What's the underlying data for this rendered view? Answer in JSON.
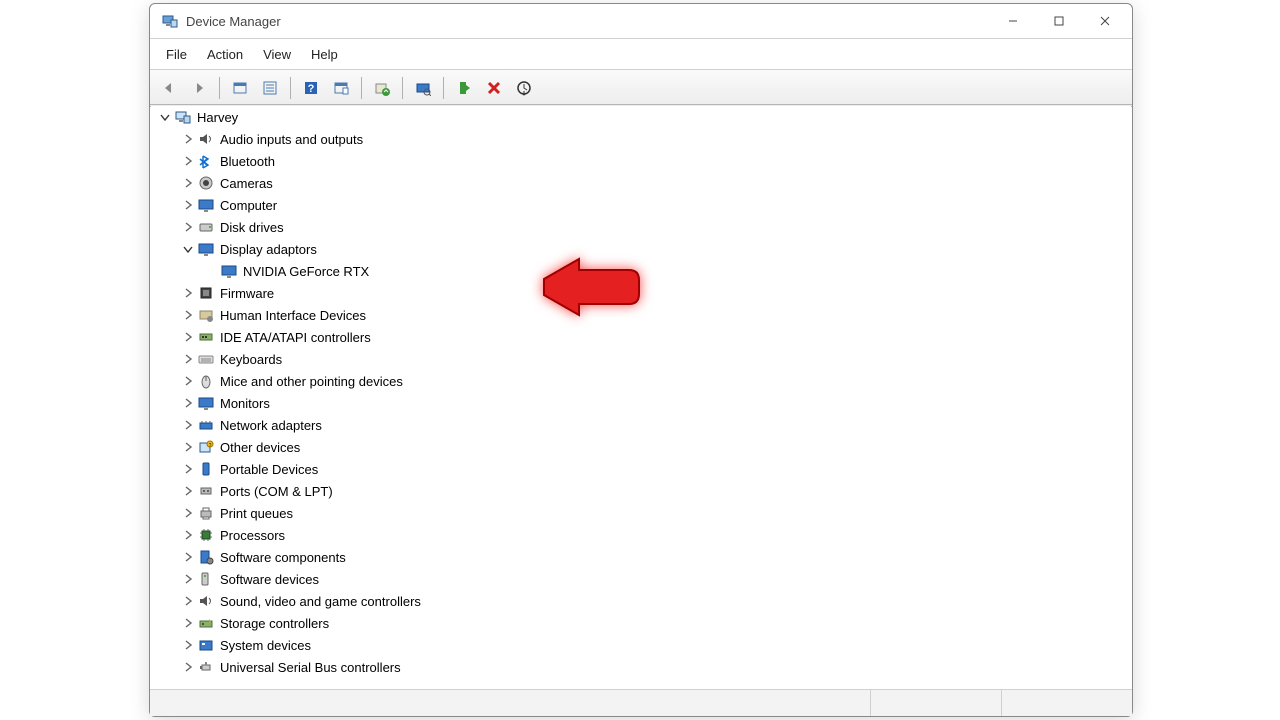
{
  "window": {
    "title": "Device Manager"
  },
  "menu": {
    "file": "File",
    "action": "Action",
    "view": "View",
    "help": "Help"
  },
  "tree": {
    "root": "Harvey",
    "items": [
      {
        "label": "Audio inputs and outputs",
        "icon": "speaker",
        "expanded": false
      },
      {
        "label": "Bluetooth",
        "icon": "bluetooth",
        "expanded": false
      },
      {
        "label": "Cameras",
        "icon": "camera",
        "expanded": false
      },
      {
        "label": "Computer",
        "icon": "monitor",
        "expanded": false
      },
      {
        "label": "Disk drives",
        "icon": "disk",
        "expanded": false
      },
      {
        "label": "Display adaptors",
        "icon": "monitor",
        "expanded": true,
        "children": [
          {
            "label": "NVIDIA GeForce RTX",
            "icon": "monitor"
          }
        ]
      },
      {
        "label": "Firmware",
        "icon": "chip",
        "expanded": false
      },
      {
        "label": "Human Interface Devices",
        "icon": "hid",
        "expanded": false
      },
      {
        "label": "IDE ATA/ATAPI controllers",
        "icon": "ide",
        "expanded": false
      },
      {
        "label": "Keyboards",
        "icon": "keyboard",
        "expanded": false
      },
      {
        "label": "Mice and other pointing devices",
        "icon": "mouse",
        "expanded": false
      },
      {
        "label": "Monitors",
        "icon": "monitor",
        "expanded": false
      },
      {
        "label": "Network adapters",
        "icon": "network",
        "expanded": false
      },
      {
        "label": "Other devices",
        "icon": "other",
        "expanded": false
      },
      {
        "label": "Portable Devices",
        "icon": "portable",
        "expanded": false
      },
      {
        "label": "Ports (COM & LPT)",
        "icon": "port",
        "expanded": false
      },
      {
        "label": "Print queues",
        "icon": "printer",
        "expanded": false
      },
      {
        "label": "Processors",
        "icon": "cpu",
        "expanded": false
      },
      {
        "label": "Software components",
        "icon": "swcomp",
        "expanded": false
      },
      {
        "label": "Software devices",
        "icon": "swdev",
        "expanded": false
      },
      {
        "label": "Sound, video and game controllers",
        "icon": "speaker",
        "expanded": false
      },
      {
        "label": "Storage controllers",
        "icon": "storage",
        "expanded": false
      },
      {
        "label": "System devices",
        "icon": "system",
        "expanded": false
      },
      {
        "label": "Universal Serial Bus controllers",
        "icon": "usb",
        "expanded": false
      }
    ]
  },
  "toolbar_buttons": [
    "back",
    "forward",
    "|",
    "show-hidden",
    "properties",
    "|",
    "help",
    "computer",
    "|",
    "update-driver",
    "|",
    "scan-hardware",
    "|",
    "enable",
    "disable",
    "uninstall"
  ]
}
